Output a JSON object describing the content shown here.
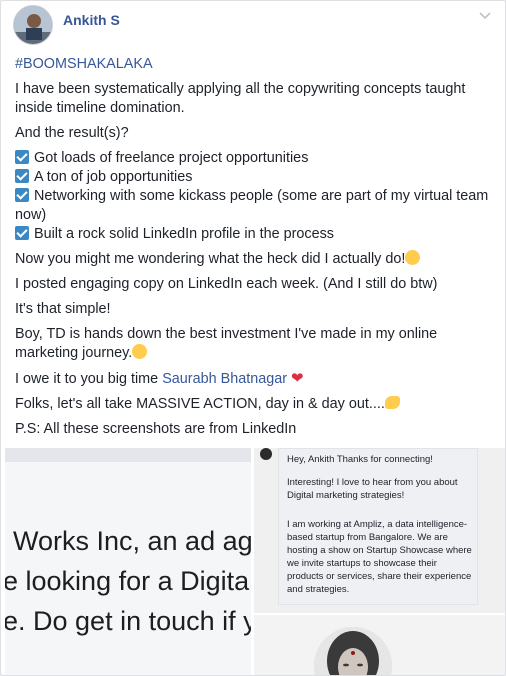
{
  "post": {
    "author": "Ankith S",
    "hashtag": "#BOOMSHAKALAKA",
    "intro": "I have been systematically applying all the copywriting concepts taught inside timeline domination.",
    "result_label": "And the result(s)?",
    "checklist": [
      "Got loads of freelance project opportunities",
      "A ton of job opportunities",
      "Networking with some kickass people (some are part of my virtual team now)",
      "Built a rock solid LinkedIn profile in the process"
    ],
    "wondering": "Now you might me wondering what the heck did I actually do!",
    "posted": "I posted engaging copy on LinkedIn each week. (And I still do btw)",
    "simple": "It's that simple!",
    "boy": "Boy, TD is hands down the best investment I've made in my online marketing journey.",
    "owe_prefix": "I owe it to you big time",
    "mention": "Saurabh Bhatnagar",
    "folks": "Folks, let's all take MASSIVE ACTION, day in & day out....",
    "ps": "P.S: All these screenshots are from LinkedIn"
  },
  "gallery": {
    "left_lines": [
      "Works Inc, an ad ag",
      "e looking for a Digita",
      "e. Do get in touch if y"
    ],
    "message": {
      "greeting": "Hey, Ankith Thanks for connecting!",
      "para1": "Interesting! I love to hear from you about Digital marketing strategies!",
      "para2": "I am working at Ampliz, a data intelligence-based startup from Bangalore. We are hosting a show on Startup Showcase where we invite startups to showcase their products or services, share their experience and strategies."
    }
  },
  "colors": {
    "link": "#365899",
    "checkbox": "#3b88c3",
    "heart": "#dd2e44"
  }
}
